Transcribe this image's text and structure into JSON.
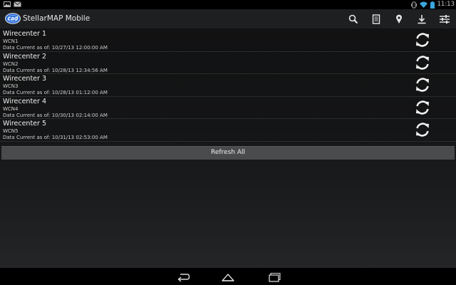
{
  "status_bar": {
    "time": "11:13",
    "icons": [
      "photo-notification-icon",
      "mail-notification-icon",
      "vibrate-icon",
      "wifi-icon",
      "battery-icon"
    ]
  },
  "action_bar": {
    "app_title": "StellarMAP Mobile",
    "logo_text": "cad",
    "actions": [
      "search-icon",
      "document-icon",
      "location-pin-icon",
      "download-icon",
      "settings-sliders-icon"
    ]
  },
  "wirecenters": [
    {
      "name": "Wirecenter 1",
      "code": "WCN1",
      "date": "Data Current as of: 10/27/13 12:00:00 AM"
    },
    {
      "name": "Wirecenter 2",
      "code": "WCN2",
      "date": "Data Current as of: 10/28/13 12:34:56 AM"
    },
    {
      "name": "Wirecenter 3",
      "code": "WCN3",
      "date": "Data Current as of: 10/28/13 01:12:00 AM"
    },
    {
      "name": "Wirecenter 4",
      "code": "WCN4",
      "date": "Data Current as of: 10/30/13 02:14:00 AM"
    },
    {
      "name": "Wirecenter 5",
      "code": "WCN5",
      "date": "Data Current as of: 10/31/13 02:53:00 AM"
    }
  ],
  "refresh_all_label": "Refresh All",
  "nav_bar": [
    "back-icon",
    "home-icon",
    "recent-apps-icon"
  ],
  "colors": {
    "background": "#141516",
    "action_bar": "#1e1f21",
    "button": "#4a4b4d",
    "text": "#f0f0f0",
    "accent_logo": "#2e6fd8"
  }
}
